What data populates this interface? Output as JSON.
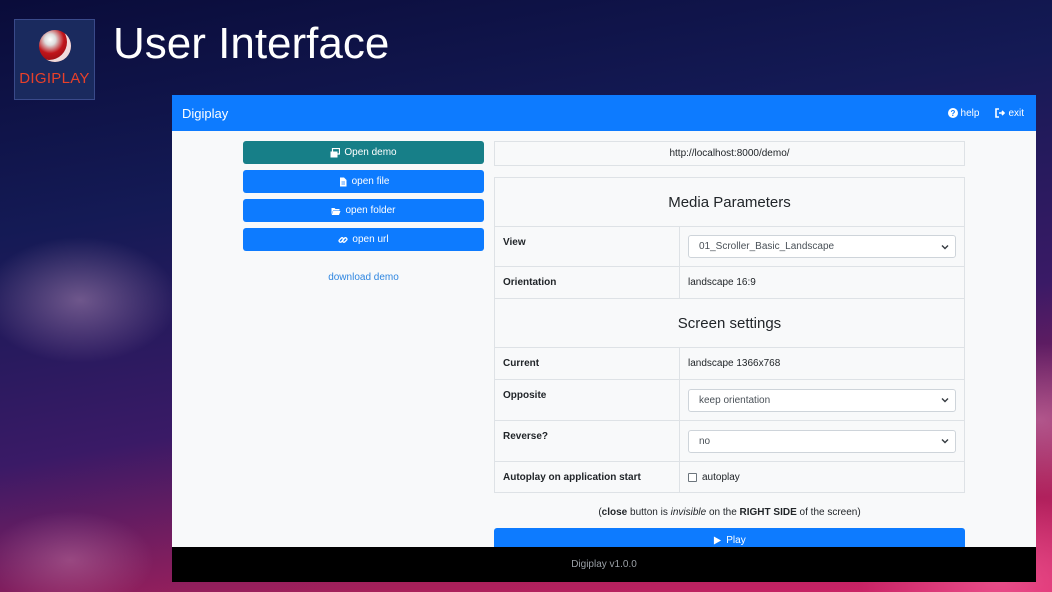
{
  "slide": {
    "logo_text": "DIGIPLAY",
    "title": "User Interface"
  },
  "navbar": {
    "brand": "Digiplay",
    "help_label": "help",
    "exit_label": "exit"
  },
  "left": {
    "buttons": [
      {
        "label": "Open demo",
        "icon": "windows-icon"
      },
      {
        "label": "open file",
        "icon": "file-icon"
      },
      {
        "label": "open folder",
        "icon": "folder-open-icon"
      },
      {
        "label": "open url",
        "icon": "link-icon"
      }
    ],
    "download_link": "download demo"
  },
  "right": {
    "url": "http://localhost:8000/demo/",
    "media_section_title": "Media Parameters",
    "view_label": "View",
    "view_value": "01_Scroller_Basic_Landscape",
    "orientation_label": "Orientation",
    "orientation_value": "landscape 16:9",
    "screen_section_title": "Screen settings",
    "current_label": "Current",
    "current_value": "landscape 1366x768",
    "opposite_label": "Opposite",
    "opposite_value": "keep orientation",
    "reverse_label": "Reverse?",
    "reverse_value": "no",
    "autoplay_label": "Autoplay on application start",
    "autoplay_checkbox_label": "autoplay",
    "note": {
      "open": "(",
      "bold1": "close",
      "t1": " button is ",
      "italic": "invisible",
      "t2": " on the ",
      "bold2": "RIGHT SIDE",
      "t3": " of the screen)"
    },
    "play_label": "Play"
  },
  "footer": {
    "version": "Digiplay v1.0.0"
  },
  "colors": {
    "primary": "#0d7bff",
    "teal": "#177f88",
    "footer_bg": "#000000"
  }
}
